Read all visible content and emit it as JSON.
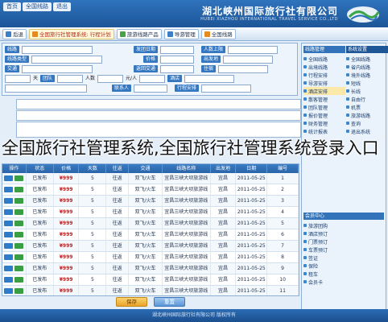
{
  "header": {
    "tabs": [
      "首页",
      "全国线路",
      "退出"
    ],
    "company_name": "湖北峡州国际旅行社有限公司",
    "company_en": "HUBEI XIAZHOU INTERNATIONAL TRAVEL SERVICE CO.,LTD"
  },
  "toolbar": {
    "items": [
      "后退",
      "全国旅行社管理系统: 行程计划",
      "旅游线路产品",
      "导游管理",
      "全国线路"
    ]
  },
  "form": {
    "row1": [
      "线路",
      "发团日期",
      "人数上限"
    ],
    "row2": [
      "线路类型",
      "价格",
      "出发地"
    ],
    "row3": [
      "交通",
      "返回交通",
      "住宿"
    ],
    "row4": [
      "天",
      "团队",
      "人数",
      "元/人",
      "酒店"
    ],
    "row5": [
      "",
      "联系人",
      "行程安排"
    ]
  },
  "sidebar": {
    "col_a_head": "线路管理",
    "col_a_items": [
      "全国线路",
      "出境线路",
      "行程安排",
      "导游安排",
      "酒店安排",
      "散客管理",
      "团队管理",
      "报价管理",
      "财务管理",
      "统计报表"
    ],
    "col_b_head": "系统设置",
    "col_b_items": [
      "全国线路",
      "省内线路",
      "境外线路",
      "短线",
      "长线",
      "自由行",
      "机票",
      "旅游线路",
      "查询",
      "退出系统"
    ],
    "section2_head": "会员中心",
    "section2_items": [
      "旅游团购",
      "酒店预订",
      "门票预订",
      "车票预订",
      "签证",
      "保险",
      "租车",
      "会员卡"
    ]
  },
  "grid": {
    "columns": [
      "操作",
      "状态",
      "价格",
      "天数",
      "往返",
      "交通",
      "线路名称",
      "出发地",
      "日期",
      "编号"
    ],
    "rows": [
      [
        "",
        "已发布",
        "¥999",
        "5",
        "往返",
        "双飞/火车",
        "宜昌三峡大坝旅游线",
        "宜昌",
        "2011-05-25",
        "1"
      ],
      [
        "",
        "已发布",
        "¥999",
        "5",
        "往返",
        "双飞/火车",
        "宜昌三峡大坝旅游线",
        "宜昌",
        "2011-05-25",
        "2"
      ],
      [
        "",
        "已发布",
        "¥999",
        "5",
        "往返",
        "双飞/火车",
        "宜昌三峡大坝旅游线",
        "宜昌",
        "2011-05-25",
        "3"
      ],
      [
        "",
        "已发布",
        "¥999",
        "5",
        "往返",
        "双飞/火车",
        "宜昌三峡大坝旅游线",
        "宜昌",
        "2011-05-25",
        "4"
      ],
      [
        "",
        "已发布",
        "¥999",
        "5",
        "往返",
        "双飞/火车",
        "宜昌三峡大坝旅游线",
        "宜昌",
        "2011-05-25",
        "5"
      ],
      [
        "",
        "已发布",
        "¥999",
        "5",
        "往返",
        "双飞/火车",
        "宜昌三峡大坝旅游线",
        "宜昌",
        "2011-05-25",
        "6"
      ],
      [
        "",
        "已发布",
        "¥999",
        "5",
        "往返",
        "双飞/火车",
        "宜昌三峡大坝旅游线",
        "宜昌",
        "2011-05-25",
        "7"
      ],
      [
        "",
        "已发布",
        "¥999",
        "5",
        "往返",
        "双飞/火车",
        "宜昌三峡大坝旅游线",
        "宜昌",
        "2011-05-25",
        "8"
      ],
      [
        "",
        "已发布",
        "¥999",
        "5",
        "往返",
        "双飞/火车",
        "宜昌三峡大坝旅游线",
        "宜昌",
        "2011-05-25",
        "9"
      ],
      [
        "",
        "已发布",
        "¥999",
        "5",
        "往返",
        "双飞/火车",
        "宜昌三峡大坝旅游线",
        "宜昌",
        "2011-05-25",
        "10"
      ],
      [
        "",
        "已发布",
        "¥999",
        "5",
        "往返",
        "双飞/火车",
        "宜昌三峡大坝旅游线",
        "宜昌",
        "2011-05-25",
        "11"
      ]
    ]
  },
  "buttons": {
    "save": "保存",
    "reset": "重置"
  },
  "footer": "湖北峡州国际旅行社有限公司 版权所有",
  "overlay_caption": "全国旅行社管理系统,全国旅行社管理系统登录入口",
  "colors": {
    "primary": "#2f73bd",
    "label": "#3477c0",
    "price": "#c41a1a"
  }
}
